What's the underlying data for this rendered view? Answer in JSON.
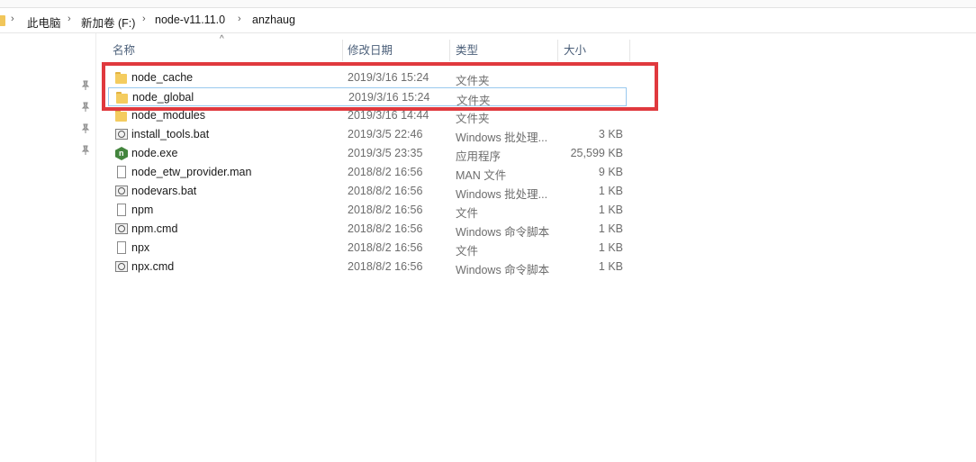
{
  "breadcrumb": [
    "此电脑",
    "新加卷 (F:)",
    "node-v11.11.0",
    "anzhaug"
  ],
  "columns": {
    "name": "名称",
    "date": "修改日期",
    "type": "类型",
    "size": "大小"
  },
  "files": [
    {
      "name": "node_cache",
      "date": "2019/3/16 15:24",
      "type": "文件夹",
      "size": "",
      "icon": "folder-icon"
    },
    {
      "name": "node_global",
      "date": "2019/3/16 15:24",
      "type": "文件夹",
      "size": "",
      "icon": "folder-icon"
    },
    {
      "name": "node_modules",
      "date": "2019/3/16 14:44",
      "type": "文件夹",
      "size": "",
      "icon": "folder-icon"
    },
    {
      "name": "install_tools.bat",
      "date": "2019/3/5 22:46",
      "type": "Windows 批处理...",
      "size": "3 KB",
      "icon": "batch-file-icon"
    },
    {
      "name": "node.exe",
      "date": "2019/3/5 23:35",
      "type": "应用程序",
      "size": "25,599 KB",
      "icon": "nodejs-icon"
    },
    {
      "name": "node_etw_provider.man",
      "date": "2018/8/2 16:56",
      "type": "MAN 文件",
      "size": "9 KB",
      "icon": "file-icon"
    },
    {
      "name": "nodevars.bat",
      "date": "2018/8/2 16:56",
      "type": "Windows 批处理...",
      "size": "1 KB",
      "icon": "batch-file-icon"
    },
    {
      "name": "npm",
      "date": "2018/8/2 16:56",
      "type": "文件",
      "size": "1 KB",
      "icon": "file-icon"
    },
    {
      "name": "npm.cmd",
      "date": "2018/8/2 16:56",
      "type": "Windows 命令脚本",
      "size": "1 KB",
      "icon": "batch-file-icon"
    },
    {
      "name": "npx",
      "date": "2018/8/2 16:56",
      "type": "文件",
      "size": "1 KB",
      "icon": "file-icon"
    },
    {
      "name": "npx.cmd",
      "date": "2018/8/2 16:56",
      "type": "Windows 命令脚本",
      "size": "1 KB",
      "icon": "batch-file-icon"
    }
  ],
  "colors": {
    "highlight": "#e0393e",
    "header_text": "#4c607a",
    "folder": "#f4cc5f"
  }
}
